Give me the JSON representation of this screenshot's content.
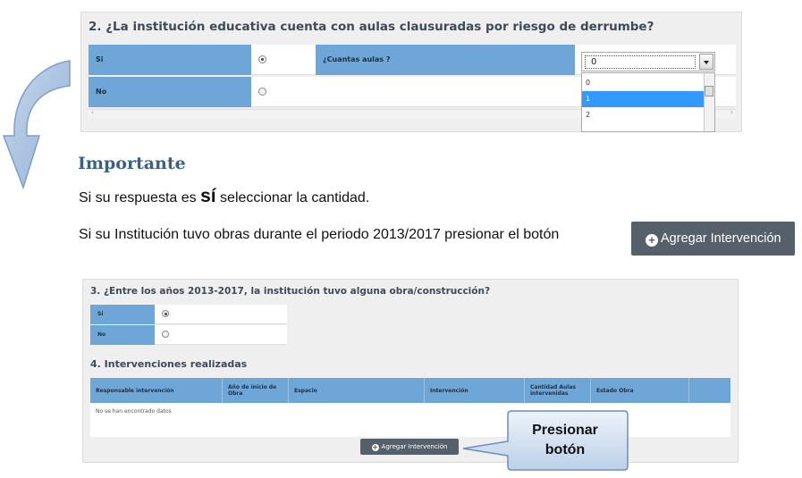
{
  "panel1": {
    "title": "2. ¿La institución educativa cuenta con aulas clausuradas por riesgo de derrumbe?",
    "rows": [
      {
        "label": "Si",
        "selected": true
      },
      {
        "label": "No",
        "selected": false
      }
    ],
    "aulas_label": "¿Cuantas aulas ?",
    "dropdown_value": "0",
    "dropdown_options": [
      "0",
      "1",
      "2"
    ]
  },
  "important": {
    "title": "Importante",
    "line1_pre": "Si su respuesta es ",
    "line1_bold": "sí",
    "line1_post": " seleccionar la cantidad.",
    "line2": "Si su Institución tuvo obras durante el periodo 2013/2017 presionar el botón",
    "button_label": "Agregar Intervención"
  },
  "panel2": {
    "title": "3. ¿Entre los años 2013-2017, la institución tuvo alguna obra/construcción?",
    "rows": [
      {
        "label": "Si",
        "selected": true
      },
      {
        "label": "No",
        "selected": false
      }
    ],
    "subtitle": "4. Intervenciones realizadas",
    "columns": [
      "Responsable intervención",
      "Año de inicio de Obra",
      "Espacio",
      "Intervención",
      "Cantidad Aulas intervenidas",
      "Estado Obra"
    ],
    "empty_text": "No se han encontrado datos",
    "button_label": "Agregar Intervención"
  },
  "callout": {
    "line1": "Presionar",
    "line2": "botón"
  },
  "colors": {
    "header_blue": "#6fa6d8",
    "button_gray": "#56606b",
    "title_blue": "#3e5f84",
    "selected_option": "#3399ff"
  }
}
